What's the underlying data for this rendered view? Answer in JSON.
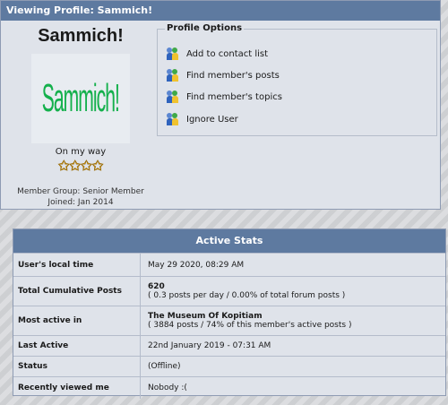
{
  "profile": {
    "title": "Viewing Profile: Sammich!",
    "username": "Sammich!",
    "avatar_text": "Sammich!",
    "rank_title": "On my way",
    "stars": "✩✩✩✩",
    "member_group": "Member Group: Senior Member",
    "joined": "Joined: Jan 2014"
  },
  "options": {
    "legend": "Profile Options",
    "items": [
      {
        "label": "Add to contact list",
        "icon": "contact-icon"
      },
      {
        "label": "Find member's posts",
        "icon": "contact-icon"
      },
      {
        "label": "Find member's topics",
        "icon": "contact-icon"
      },
      {
        "label": "Ignore User",
        "icon": "contact-icon"
      }
    ]
  },
  "stats": {
    "title": "Active Stats",
    "rows": [
      {
        "label": "User's local time",
        "value": "May 29 2020, 08:29 AM",
        "sub": ""
      },
      {
        "label": "Total Cumulative Posts",
        "value": "620",
        "sub": "( 0.3 posts per day / 0.00% of total forum posts )"
      },
      {
        "label": "Most active in",
        "value": "The Museum Of Kopitiam",
        "sub": "( 3884 posts / 74% of this member's active posts )"
      },
      {
        "label": "Last Active",
        "value": "22nd January 2019 - 07:31 AM",
        "sub": ""
      },
      {
        "label": "Status",
        "value": "(Offline)",
        "sub": ""
      },
      {
        "label": "Recently viewed me",
        "value": "Nobody :(",
        "sub": ""
      }
    ]
  },
  "colors": {
    "header": "#5e7aa0",
    "panel": "#dfe3ea",
    "avatar_text": "#14b04c",
    "stars": "#f3b21b"
  }
}
